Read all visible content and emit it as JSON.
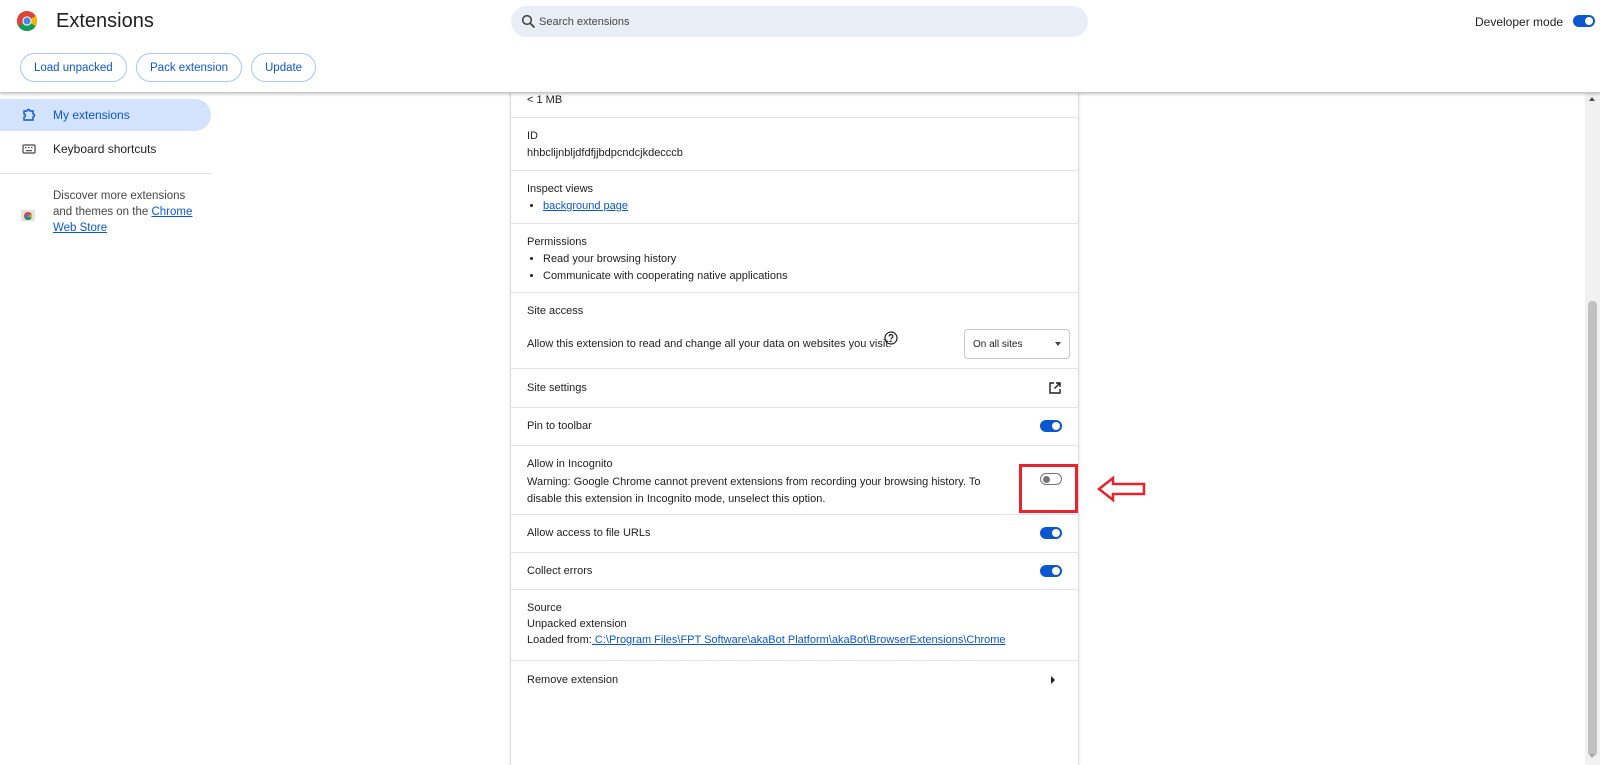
{
  "header": {
    "title": "Extensions",
    "search_placeholder": "Search extensions",
    "developer_mode_label": "Developer mode",
    "developer_mode_on": true,
    "buttons": {
      "load_unpacked": "Load unpacked",
      "pack_extension": "Pack extension",
      "update": "Update"
    }
  },
  "sidebar": {
    "items": [
      {
        "label": "My extensions",
        "icon": "puzzle-icon",
        "selected": true
      },
      {
        "label": "Keyboard shortcuts",
        "icon": "keyboard-icon",
        "selected": false
      }
    ],
    "discover_text": "Discover more extensions and themes on the ",
    "webstore_link": "Chrome Web Store"
  },
  "details": {
    "size": "< 1 MB",
    "id_label": "ID",
    "id_value": "hhbclijnbljdfdfjjbdpcndcjkdecccb",
    "inspect_label": "Inspect views",
    "inspect_link": "background page",
    "permissions_label": "Permissions",
    "permissions": [
      "Read your browsing history",
      "Communicate with cooperating native applications"
    ],
    "site_access_label": "Site access",
    "site_access_text": "Allow this extension to read and change all your data on websites you visit:",
    "site_access_value": "On all sites",
    "site_settings_label": "Site settings",
    "pin_label": "Pin to toolbar",
    "pin_on": true,
    "incognito_label": "Allow in Incognito",
    "incognito_warning": "Warning: Google Chrome cannot prevent extensions from recording your browsing history. To disable this extension in Incognito mode, unselect this option.",
    "incognito_on": false,
    "file_urls_label": "Allow access to file URLs",
    "file_urls_on": true,
    "collect_errors_label": "Collect errors",
    "collect_errors_on": true,
    "source_label": "Source",
    "source_type": "Unpacked extension",
    "loaded_from_label": "Loaded from:",
    "loaded_from_path": " C:\\Program Files\\FPT Software\\akaBot Platform\\akaBot\\BrowserExtensions\\Chrome",
    "remove_label": "Remove extension"
  },
  "colors": {
    "accent": "#0b57d0",
    "annotation": "#e8232b",
    "selected_bg": "#d3e3fd"
  }
}
